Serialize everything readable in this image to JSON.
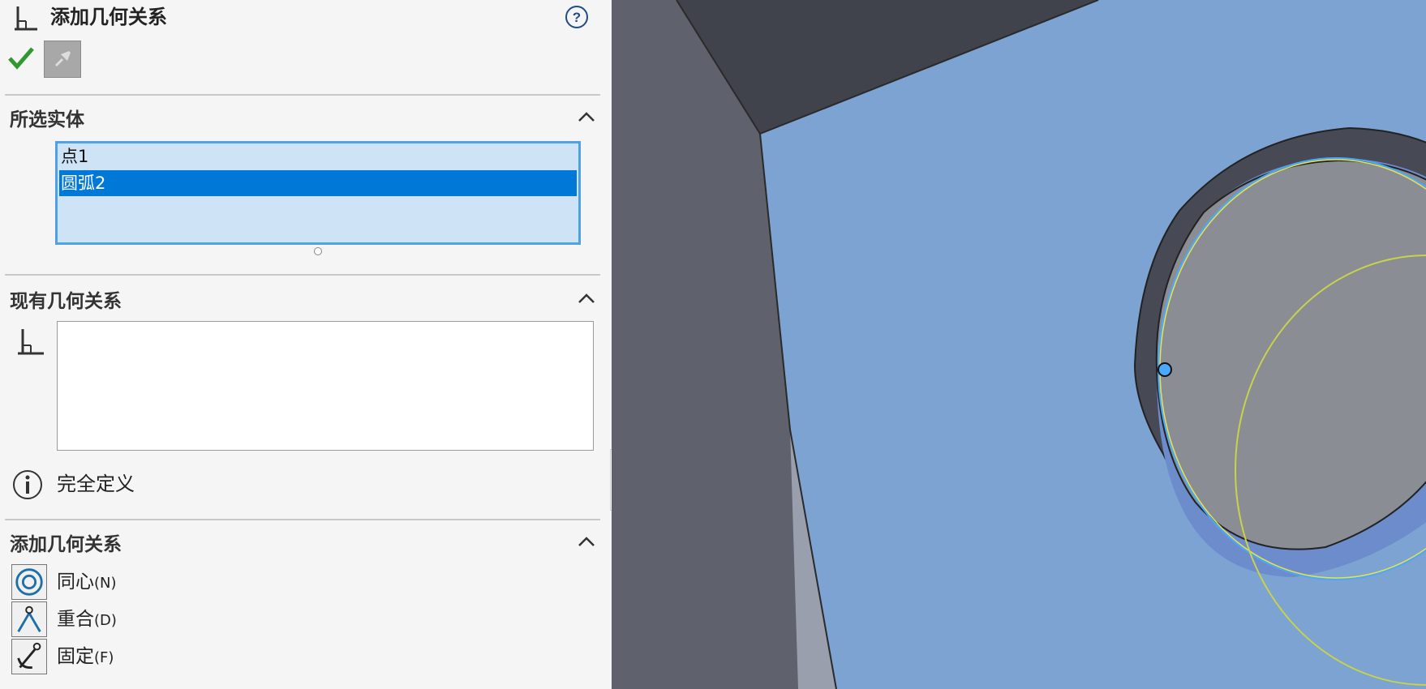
{
  "panel": {
    "title": "添加几何关系",
    "sections": {
      "selected": {
        "header": "所选实体",
        "items": [
          {
            "label": "点1",
            "selected": false
          },
          {
            "label": "圆弧2",
            "selected": true
          }
        ]
      },
      "existing": {
        "header": "现有几何关系",
        "status": "完全定义"
      },
      "add": {
        "header": "添加几何关系",
        "items": [
          {
            "label": "同心",
            "key": "(N)",
            "icon": "concentric-icon"
          },
          {
            "label": "重合",
            "key": "(D)",
            "icon": "coincident-icon"
          },
          {
            "label": "固定",
            "key": "(F)",
            "icon": "fix-anchor-icon"
          }
        ]
      }
    }
  },
  "colors": {
    "accent": "#0078d7",
    "face_blue": "#7ca3d2",
    "hole_gray": "#8b8d95",
    "dark_wall": "#5f616c",
    "sketch_yellow": "#c8d24a",
    "ok_green": "#2e9a2e"
  }
}
